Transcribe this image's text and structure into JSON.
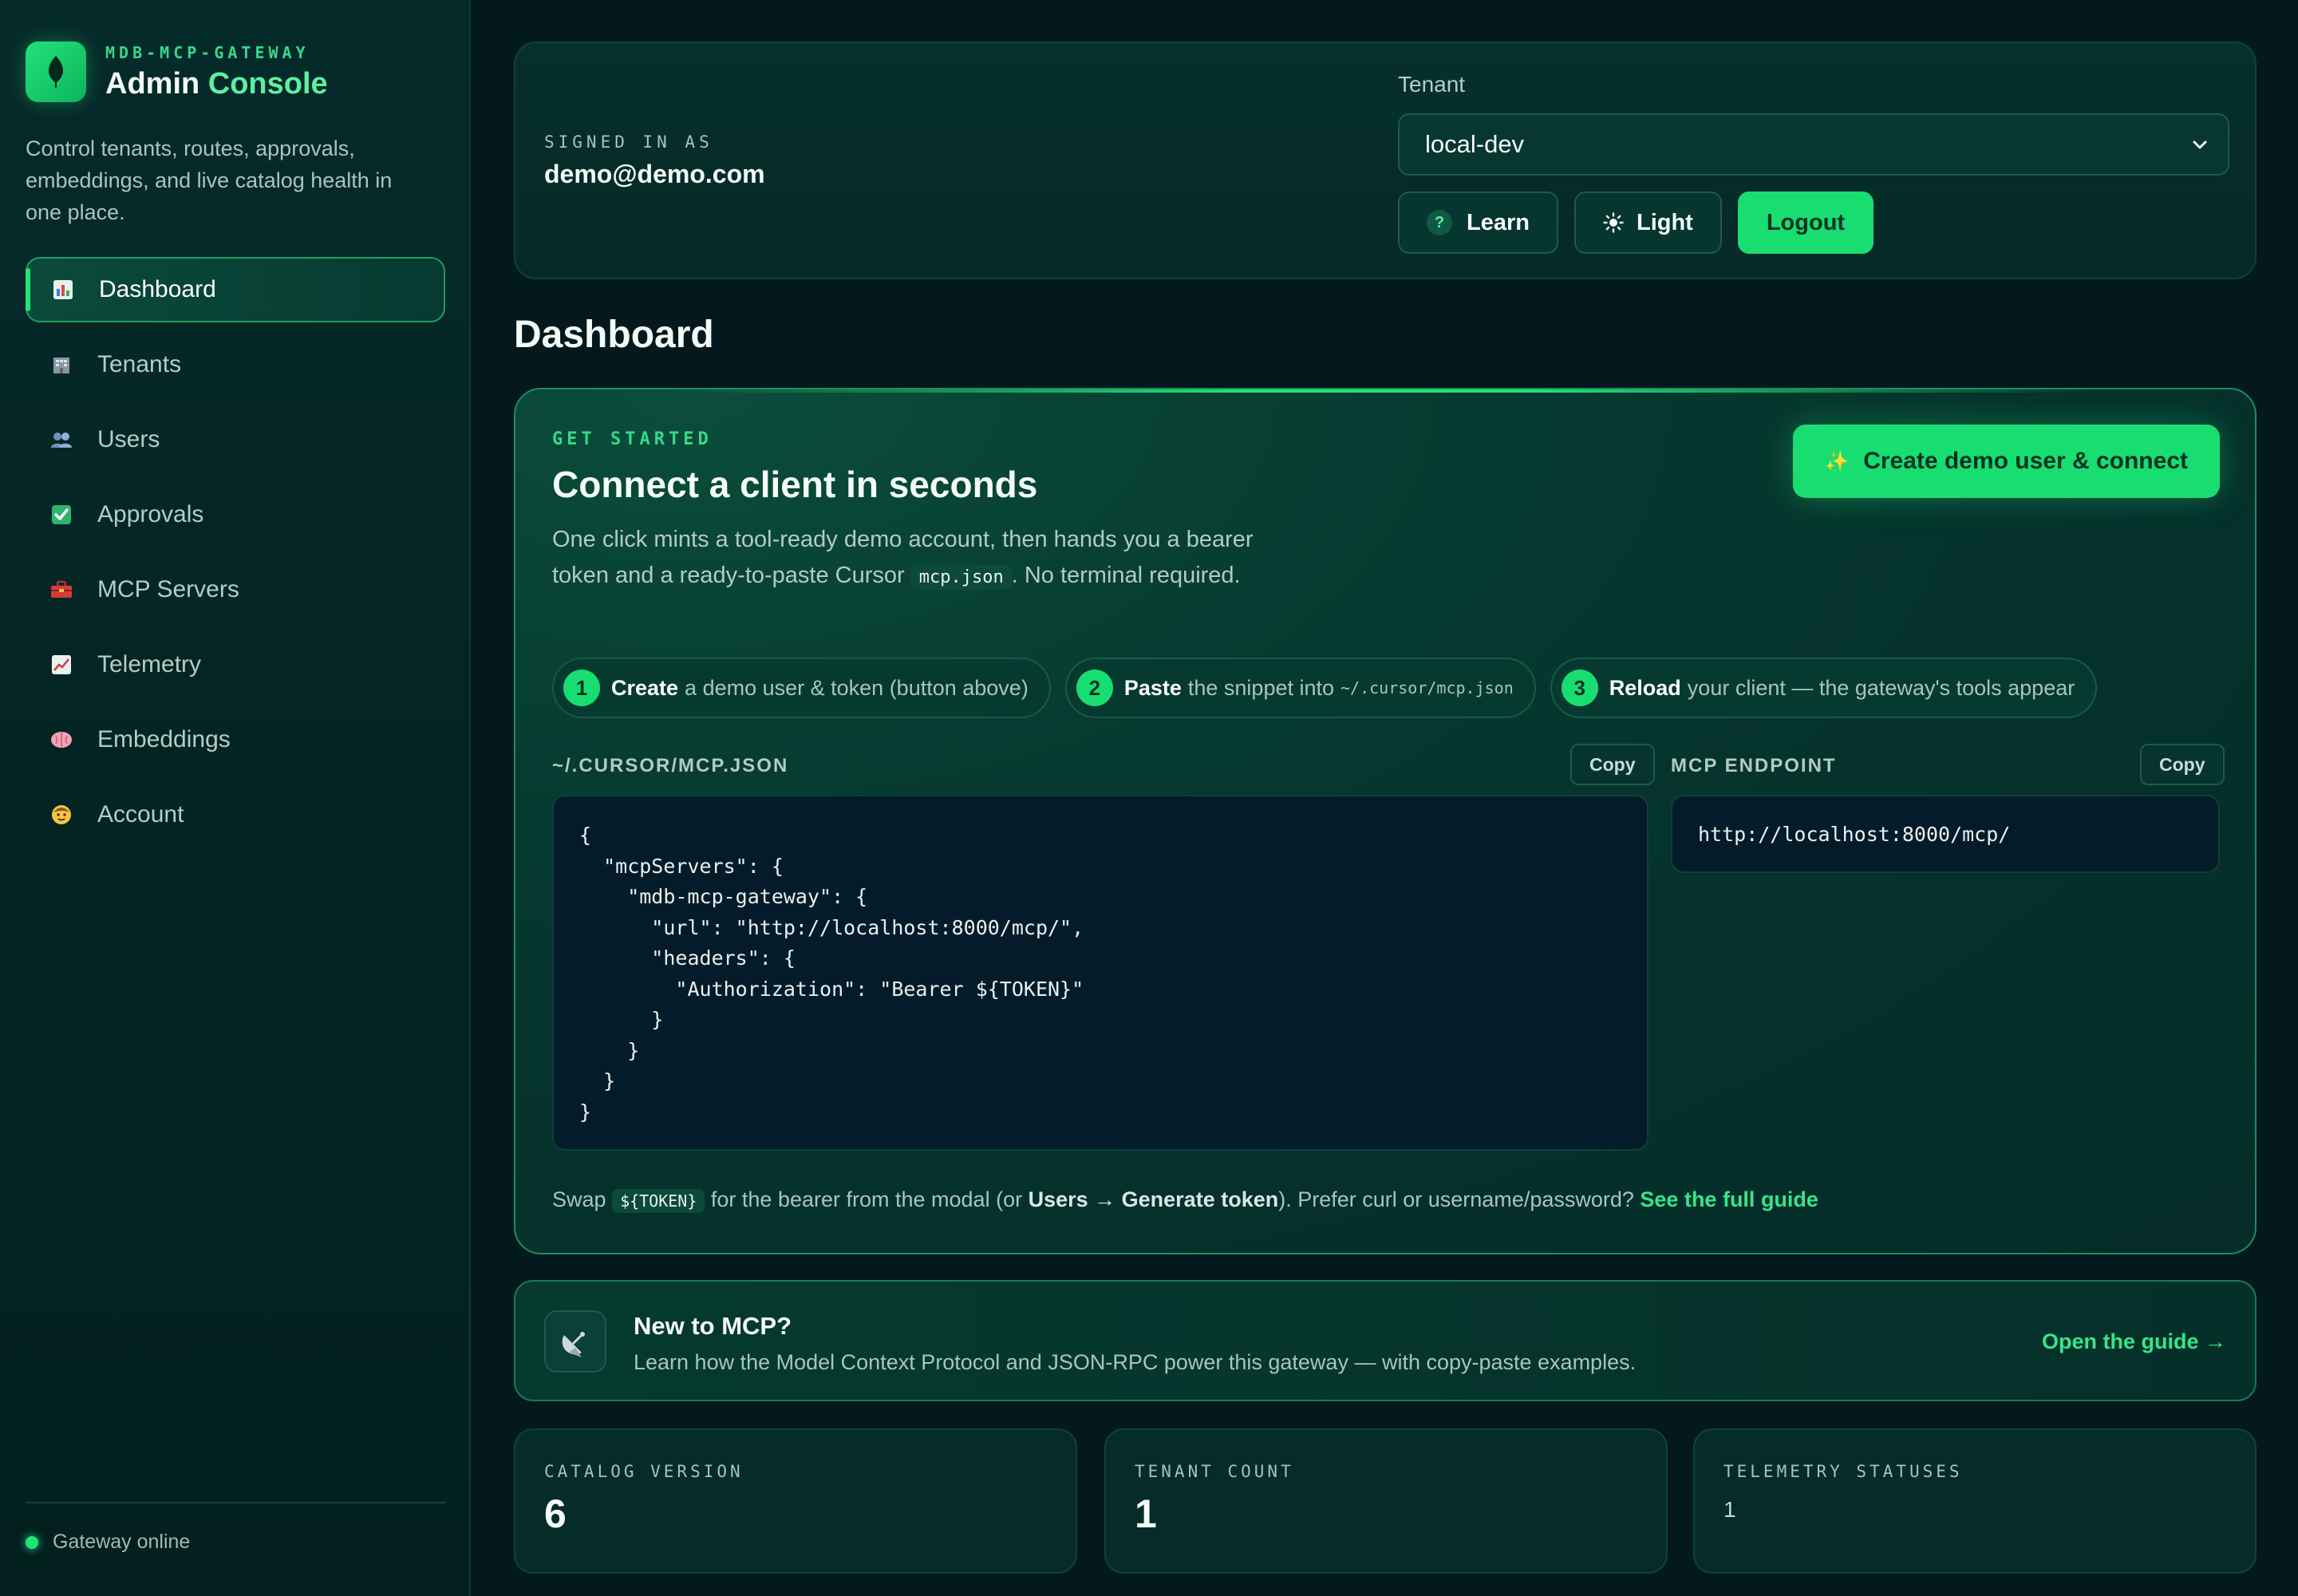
{
  "brand": {
    "kicker": "MDB-MCP-GATEWAY",
    "title_main": "Admin",
    "title_accent": "Console"
  },
  "sidebar": {
    "description": "Control tenants, routes, approvals, embeddings, and live catalog health in one place.",
    "items": [
      {
        "label": "Dashboard",
        "icon": "bar-chart-icon",
        "active": true
      },
      {
        "label": "Tenants",
        "icon": "building-icon"
      },
      {
        "label": "Users",
        "icon": "users-icon"
      },
      {
        "label": "Approvals",
        "icon": "check-box-icon"
      },
      {
        "label": "MCP Servers",
        "icon": "toolbox-icon"
      },
      {
        "label": "Telemetry",
        "icon": "line-chart-icon"
      },
      {
        "label": "Embeddings",
        "icon": "brain-icon"
      },
      {
        "label": "Account",
        "icon": "face-icon"
      }
    ],
    "footer_status": "Gateway online"
  },
  "topbar": {
    "signed_in_label": "SIGNED IN AS",
    "email": "demo@demo.com",
    "tenant_label": "Tenant",
    "tenant_value": "local-dev",
    "learn_label": "Learn",
    "theme_label": "Light",
    "logout_label": "Logout"
  },
  "page_title": "Dashboard",
  "hero": {
    "kicker": "GET STARTED",
    "title": "Connect a client in seconds",
    "desc_before": "One click mints a tool-ready demo account, then hands you a bearer token and a ready-to-paste Cursor",
    "desc_code": "mcp.json",
    "desc_after": ". No terminal required.",
    "cta": "Create demo user & connect",
    "steps": [
      {
        "num": "1",
        "bold": "Create",
        "text": "a demo user & token (button above)",
        "mono": ""
      },
      {
        "num": "2",
        "bold": "Paste",
        "text": "the snippet into",
        "mono": "~/.cursor/mcp.json"
      },
      {
        "num": "3",
        "bold": "Reload",
        "text": "your client — the gateway's tools appear",
        "mono": ""
      }
    ],
    "config_label": "~/.CURSOR/MCP.JSON",
    "copy_label": "Copy",
    "config_code": "{\n  \"mcpServers\": {\n    \"mdb-mcp-gateway\": {\n      \"url\": \"http://localhost:8000/mcp/\",\n      \"headers\": {\n        \"Authorization\": \"Bearer ${TOKEN}\"\n      }\n    }\n  }\n}",
    "endpoint_label": "MCP ENDPOINT",
    "endpoint_copy_label": "Copy",
    "endpoint_value": "http://localhost:8000/mcp/",
    "foot_swap": "Swap",
    "foot_token": "${TOKEN}",
    "foot_mid": "for the bearer from the modal (or",
    "foot_bold": "Users → Generate token",
    "foot_after": "). Prefer curl or username/password?",
    "foot_link": "See the full guide"
  },
  "newcard": {
    "icon": "satellite-dish-icon",
    "title": "New to MCP?",
    "desc": "Learn how the Model Context Protocol and JSON-RPC power this gateway — with copy-paste examples.",
    "link": "Open the guide →"
  },
  "stats": [
    {
      "label": "CATALOG VERSION",
      "value": "6"
    },
    {
      "label": "TENANT COUNT",
      "value": "1"
    },
    {
      "label": "TELEMETRY STATUSES",
      "value": "1"
    }
  ],
  "colors": {
    "accent": "#18de72",
    "background": "#03191d",
    "panel": "#052c29"
  }
}
